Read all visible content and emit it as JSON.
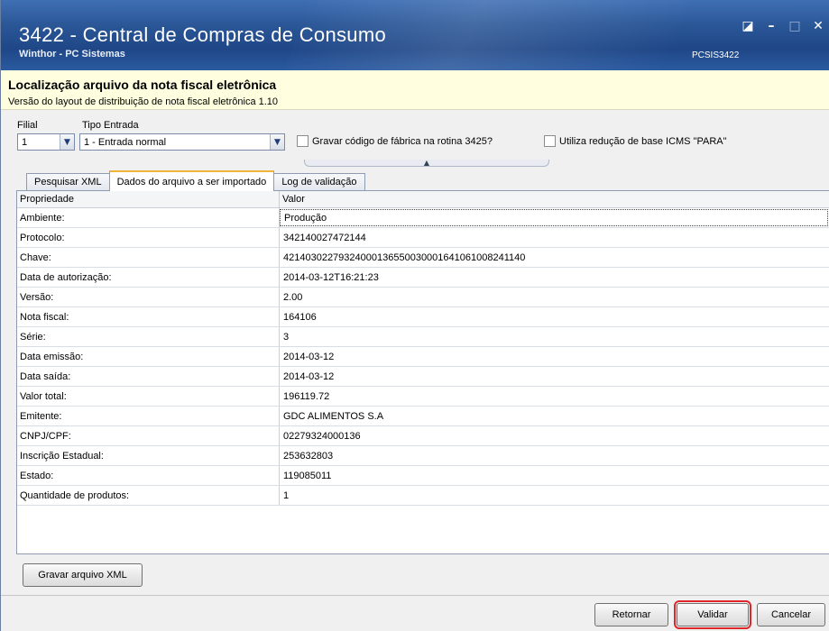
{
  "window": {
    "title": "3422 - Central de Compras de Consumo",
    "subtitle": "Winthor - PC Sistemas",
    "code": "PCSIS3422"
  },
  "header": {
    "heading": "Localização arquivo da nota fiscal eletrônica",
    "subheading": "Versão do layout de distribuição de nota fiscal eletrônica 1.10"
  },
  "filters": {
    "filial_label": "Filial",
    "filial_value": "1",
    "tipo_label": "Tipo Entrada",
    "tipo_value": "1 - Entrada normal",
    "check1_label": "Gravar código de fábrica na rotina 3425?",
    "check2_label": "Utiliza redução de base ICMS \"PARA\""
  },
  "tabs": [
    {
      "label": "Pesquisar XML"
    },
    {
      "label": "Dados do arquivo a ser importado"
    },
    {
      "label": "Log de validação"
    }
  ],
  "grid": {
    "headers": [
      "Propriedade",
      "Valor"
    ],
    "rows": [
      {
        "prop": "Ambiente:",
        "value": "Produção"
      },
      {
        "prop": "Protocolo:",
        "value": "342140027472144"
      },
      {
        "prop": "Chave:",
        "value": "42140302279324000136550030001641061008241140"
      },
      {
        "prop": "Data de autorização:",
        "value": "2014-03-12T16:21:23"
      },
      {
        "prop": "Versão:",
        "value": "2.00"
      },
      {
        "prop": "Nota fiscal:",
        "value": "164106"
      },
      {
        "prop": "Série:",
        "value": "3"
      },
      {
        "prop": "Data emissão:",
        "value": "2014-03-12"
      },
      {
        "prop": "Data saída:",
        "value": "2014-03-12"
      },
      {
        "prop": "Valor total:",
        "value": "196119.72"
      },
      {
        "prop": "Emitente:",
        "value": "GDC ALIMENTOS S.A"
      },
      {
        "prop": "CNPJ/CPF:",
        "value": "02279324000136"
      },
      {
        "prop": "Inscrição Estadual:",
        "value": "253632803"
      },
      {
        "prop": "Estado:",
        "value": "119085011"
      },
      {
        "prop": "Quantidade de produtos:",
        "value": "1"
      }
    ]
  },
  "buttons": {
    "gravar_xml": "Gravar arquivo XML",
    "retornar": "Retornar",
    "validar": "Validar",
    "cancelar": "Cancelar"
  },
  "colors": {
    "titlebar": "#2b5797",
    "header_band": "#ffffe0",
    "highlight": "#e0262a"
  }
}
